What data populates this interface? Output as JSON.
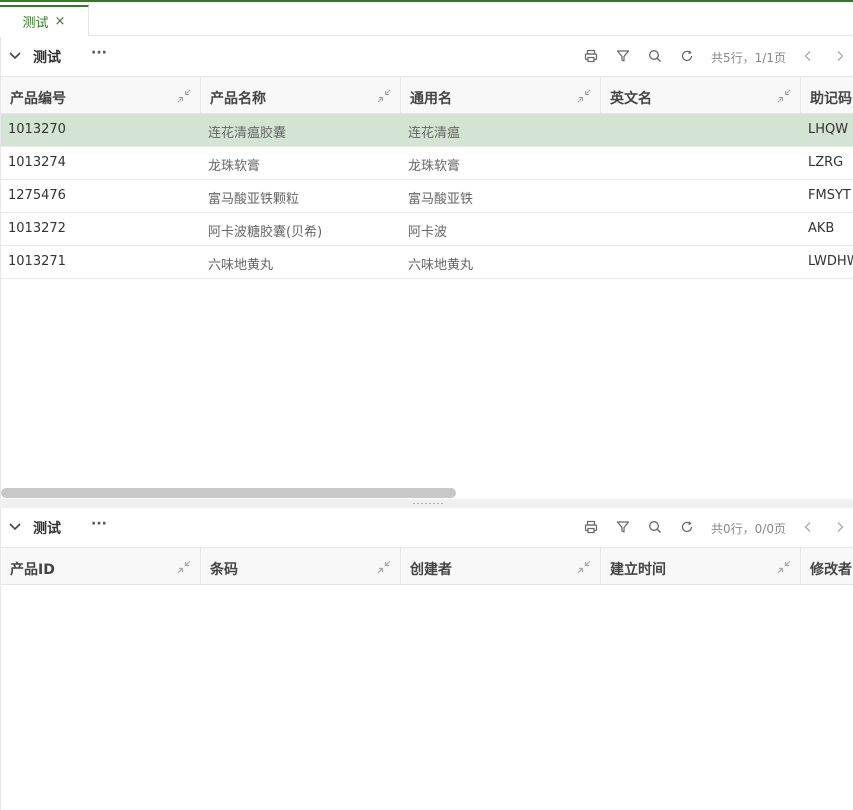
{
  "tabs": [
    {
      "label": "测试",
      "close": "×",
      "active": true
    }
  ],
  "colors": {
    "accent": "#2f7d1f",
    "selected_row": "#d4e4d2"
  },
  "icons": [
    "chevron-down-icon",
    "more-icon",
    "print-icon",
    "filter-icon",
    "search-icon",
    "refresh-icon",
    "prev-page-icon",
    "next-page-icon",
    "shrink-column-icon"
  ],
  "top_panel": {
    "title": "测试",
    "more": "···",
    "pager": "共5行，1/1页",
    "columns": [
      "产品编号",
      "产品名称",
      "通用名",
      "英文名",
      "助记码"
    ],
    "rows": [
      [
        "1013270",
        "连花清瘟胶囊",
        "连花清瘟",
        "",
        "LHQW"
      ],
      [
        "1013274",
        "龙珠软膏",
        "龙珠软膏",
        "",
        "LZRG"
      ],
      [
        "1275476",
        "富马酸亚铁颗粒",
        "富马酸亚铁",
        "",
        "FMSYT"
      ],
      [
        "1013272",
        "阿卡波糖胶囊(贝希)",
        "阿卡波",
        "",
        "AKB"
      ],
      [
        "1013271",
        "六味地黄丸",
        "六味地黄丸",
        "",
        "LWDHW"
      ]
    ],
    "selected_row": 0
  },
  "bottom_panel": {
    "title": "测试",
    "more": "···",
    "pager": "共0行，0/0页",
    "columns": [
      "产品ID",
      "条码",
      "创建者",
      "建立时间",
      "修改者"
    ],
    "rows": []
  }
}
